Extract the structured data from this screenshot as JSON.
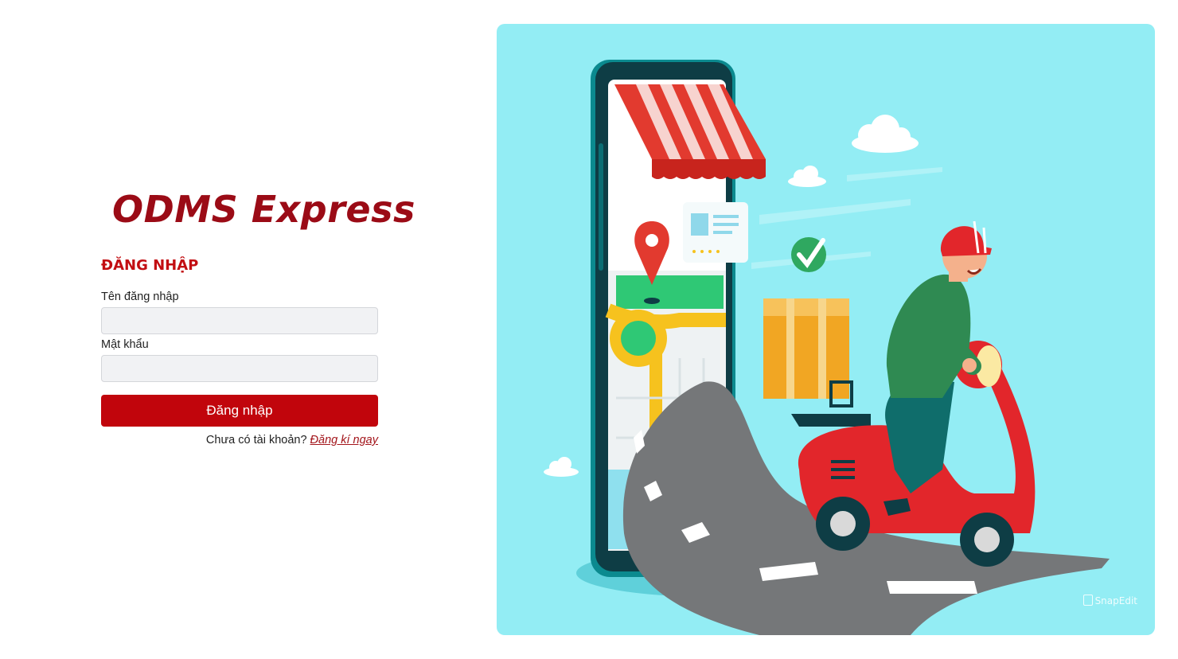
{
  "brand": {
    "name": "ODMS Express"
  },
  "login_form": {
    "title": "ĐĂNG NHẬP",
    "username_label": "Tên đăng nhập",
    "username_value": "",
    "password_label": "Mật khẩu",
    "password_value": "",
    "submit_label": "Đăng nhập",
    "signup_prompt": "Chưa có tài khoản?",
    "signup_link": "Đăng kí ngay"
  },
  "hero": {
    "icons": [
      "smartphone",
      "shop-awning",
      "map-pin-icon",
      "check-icon",
      "delivery-box",
      "scooter",
      "cloud-icon"
    ],
    "watermark": "SnapEdit"
  },
  "colors": {
    "brand": "#9b0b16",
    "accent": "#c1050c",
    "hero_bg": "#93edf4",
    "scooter": "#e2262b"
  }
}
